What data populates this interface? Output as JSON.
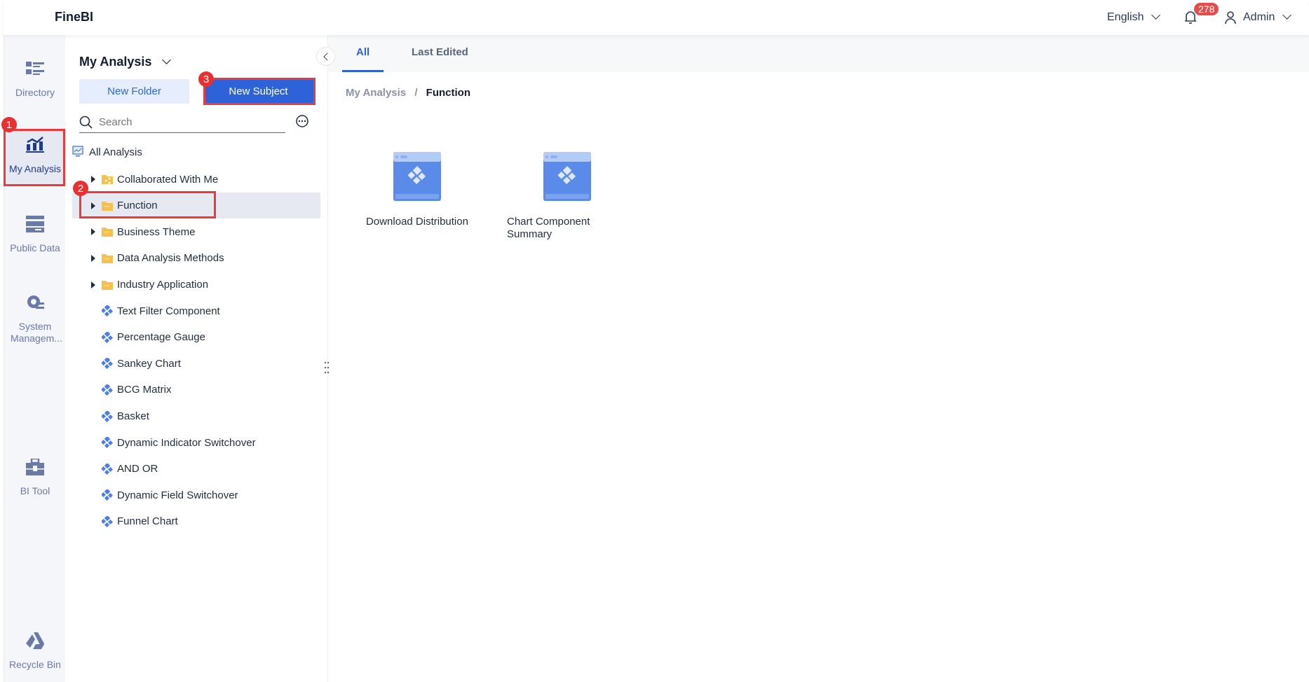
{
  "header": {
    "logo": "FineBI",
    "language": "English",
    "notification_count": "278",
    "user": "Admin"
  },
  "rail": {
    "items": [
      {
        "label": "Directory",
        "icon": "directory-icon"
      },
      {
        "label": "My Analysis",
        "icon": "my-analysis-icon",
        "active": true
      },
      {
        "label": "Public Data",
        "icon": "public-data-icon"
      },
      {
        "label": "System Managem...",
        "icon": "system-management-icon"
      },
      {
        "label": "BI Tool",
        "icon": "bi-tool-icon"
      },
      {
        "label": "Recycle Bin",
        "icon": "recycle-bin-icon"
      }
    ]
  },
  "panel": {
    "title": "My Analysis",
    "new_folder": "New Folder",
    "new_subject": "New Subject",
    "search_placeholder": "Search",
    "tree": [
      {
        "label": "All Analysis",
        "type": "root"
      },
      {
        "label": "Collaborated With Me",
        "type": "shared-folder"
      },
      {
        "label": "Function",
        "type": "folder",
        "selected": true
      },
      {
        "label": "Business Theme",
        "type": "folder"
      },
      {
        "label": "Data Analysis Methods",
        "type": "folder"
      },
      {
        "label": "Industry Application",
        "type": "folder"
      },
      {
        "label": "Text Filter Component",
        "type": "subject"
      },
      {
        "label": "Percentage Gauge",
        "type": "subject"
      },
      {
        "label": "Sankey Chart",
        "type": "subject"
      },
      {
        "label": "BCG Matrix",
        "type": "subject"
      },
      {
        "label": "Basket",
        "type": "subject"
      },
      {
        "label": "Dynamic Indicator Switchover",
        "type": "subject"
      },
      {
        "label": "AND OR",
        "type": "subject"
      },
      {
        "label": "Dynamic Field Switchover",
        "type": "subject"
      },
      {
        "label": "Funnel Chart",
        "type": "subject"
      }
    ]
  },
  "annotations": [
    "1",
    "2",
    "3"
  ],
  "main": {
    "tabs": [
      {
        "label": "All",
        "active": true
      },
      {
        "label": "Last Edited"
      }
    ],
    "breadcrumb": {
      "parent": "My Analysis",
      "separator": "/",
      "current": "Function"
    },
    "items": [
      {
        "name": "Download Distribution"
      },
      {
        "name": "Chart Component Summary"
      }
    ]
  },
  "colors": {
    "accent": "#2e62d9",
    "highlight": "#ec3a3a",
    "folder": "#f7c04a",
    "rail_icon": "#6b79a8"
  }
}
